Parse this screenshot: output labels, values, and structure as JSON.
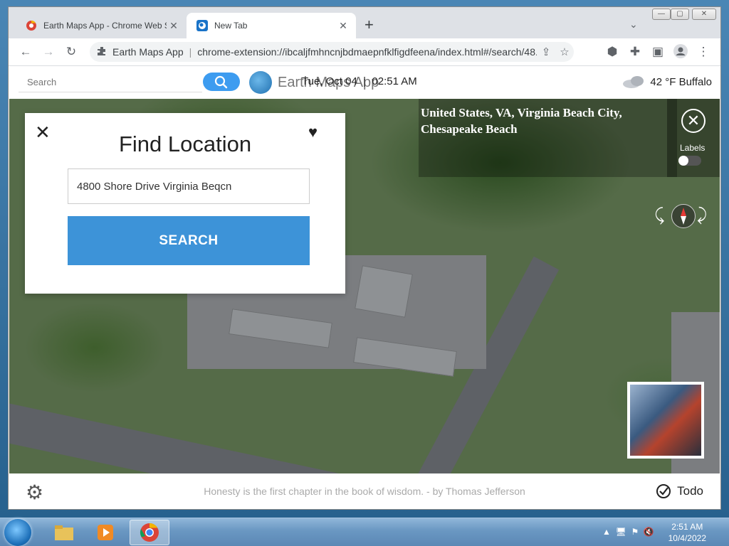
{
  "browser": {
    "tabs": [
      {
        "title": "Earth Maps App - Chrome Web S",
        "active": false
      },
      {
        "title": "New Tab",
        "active": true
      }
    ],
    "new_tab_label": "+",
    "omnibox": {
      "extension_name": "Earth Maps App",
      "separator": "|",
      "url": "chrome-extension://ibcaljfmhncnjbdmaepnfklfigdfeena/index.html#/search/48..."
    },
    "icons": [
      "back-icon",
      "forward-icon",
      "reload-icon",
      "share-icon",
      "star-icon",
      "extension-icon",
      "puzzle-icon",
      "sidepanel-icon",
      "profile-icon",
      "menu-icon"
    ]
  },
  "app_header": {
    "search_placeholder": "Search",
    "logo_text": "Earth Maps App",
    "date": "Tue, Oct 04",
    "divider": "|",
    "time": "02:51 AM",
    "weather": "42 °F Buffalo"
  },
  "map": {
    "location": "United States, VA, Virginia Beach City, Chesapeake Beach",
    "labels_label": "Labels",
    "labels_on": false
  },
  "find_panel": {
    "title": "Find Location",
    "input_value": "4800 Shore Drive Virginia Beqcn",
    "search_button": "SEARCH"
  },
  "footer": {
    "quote": "Honesty is the first chapter in the book of wisdom. - by Thomas Jefferson",
    "todo_label": "Todo"
  },
  "taskbar": {
    "time": "2:51 AM",
    "date": "10/4/2022"
  },
  "colors": {
    "accent_blue": "#3d93d8",
    "search_pill": "#3d9cf0"
  }
}
